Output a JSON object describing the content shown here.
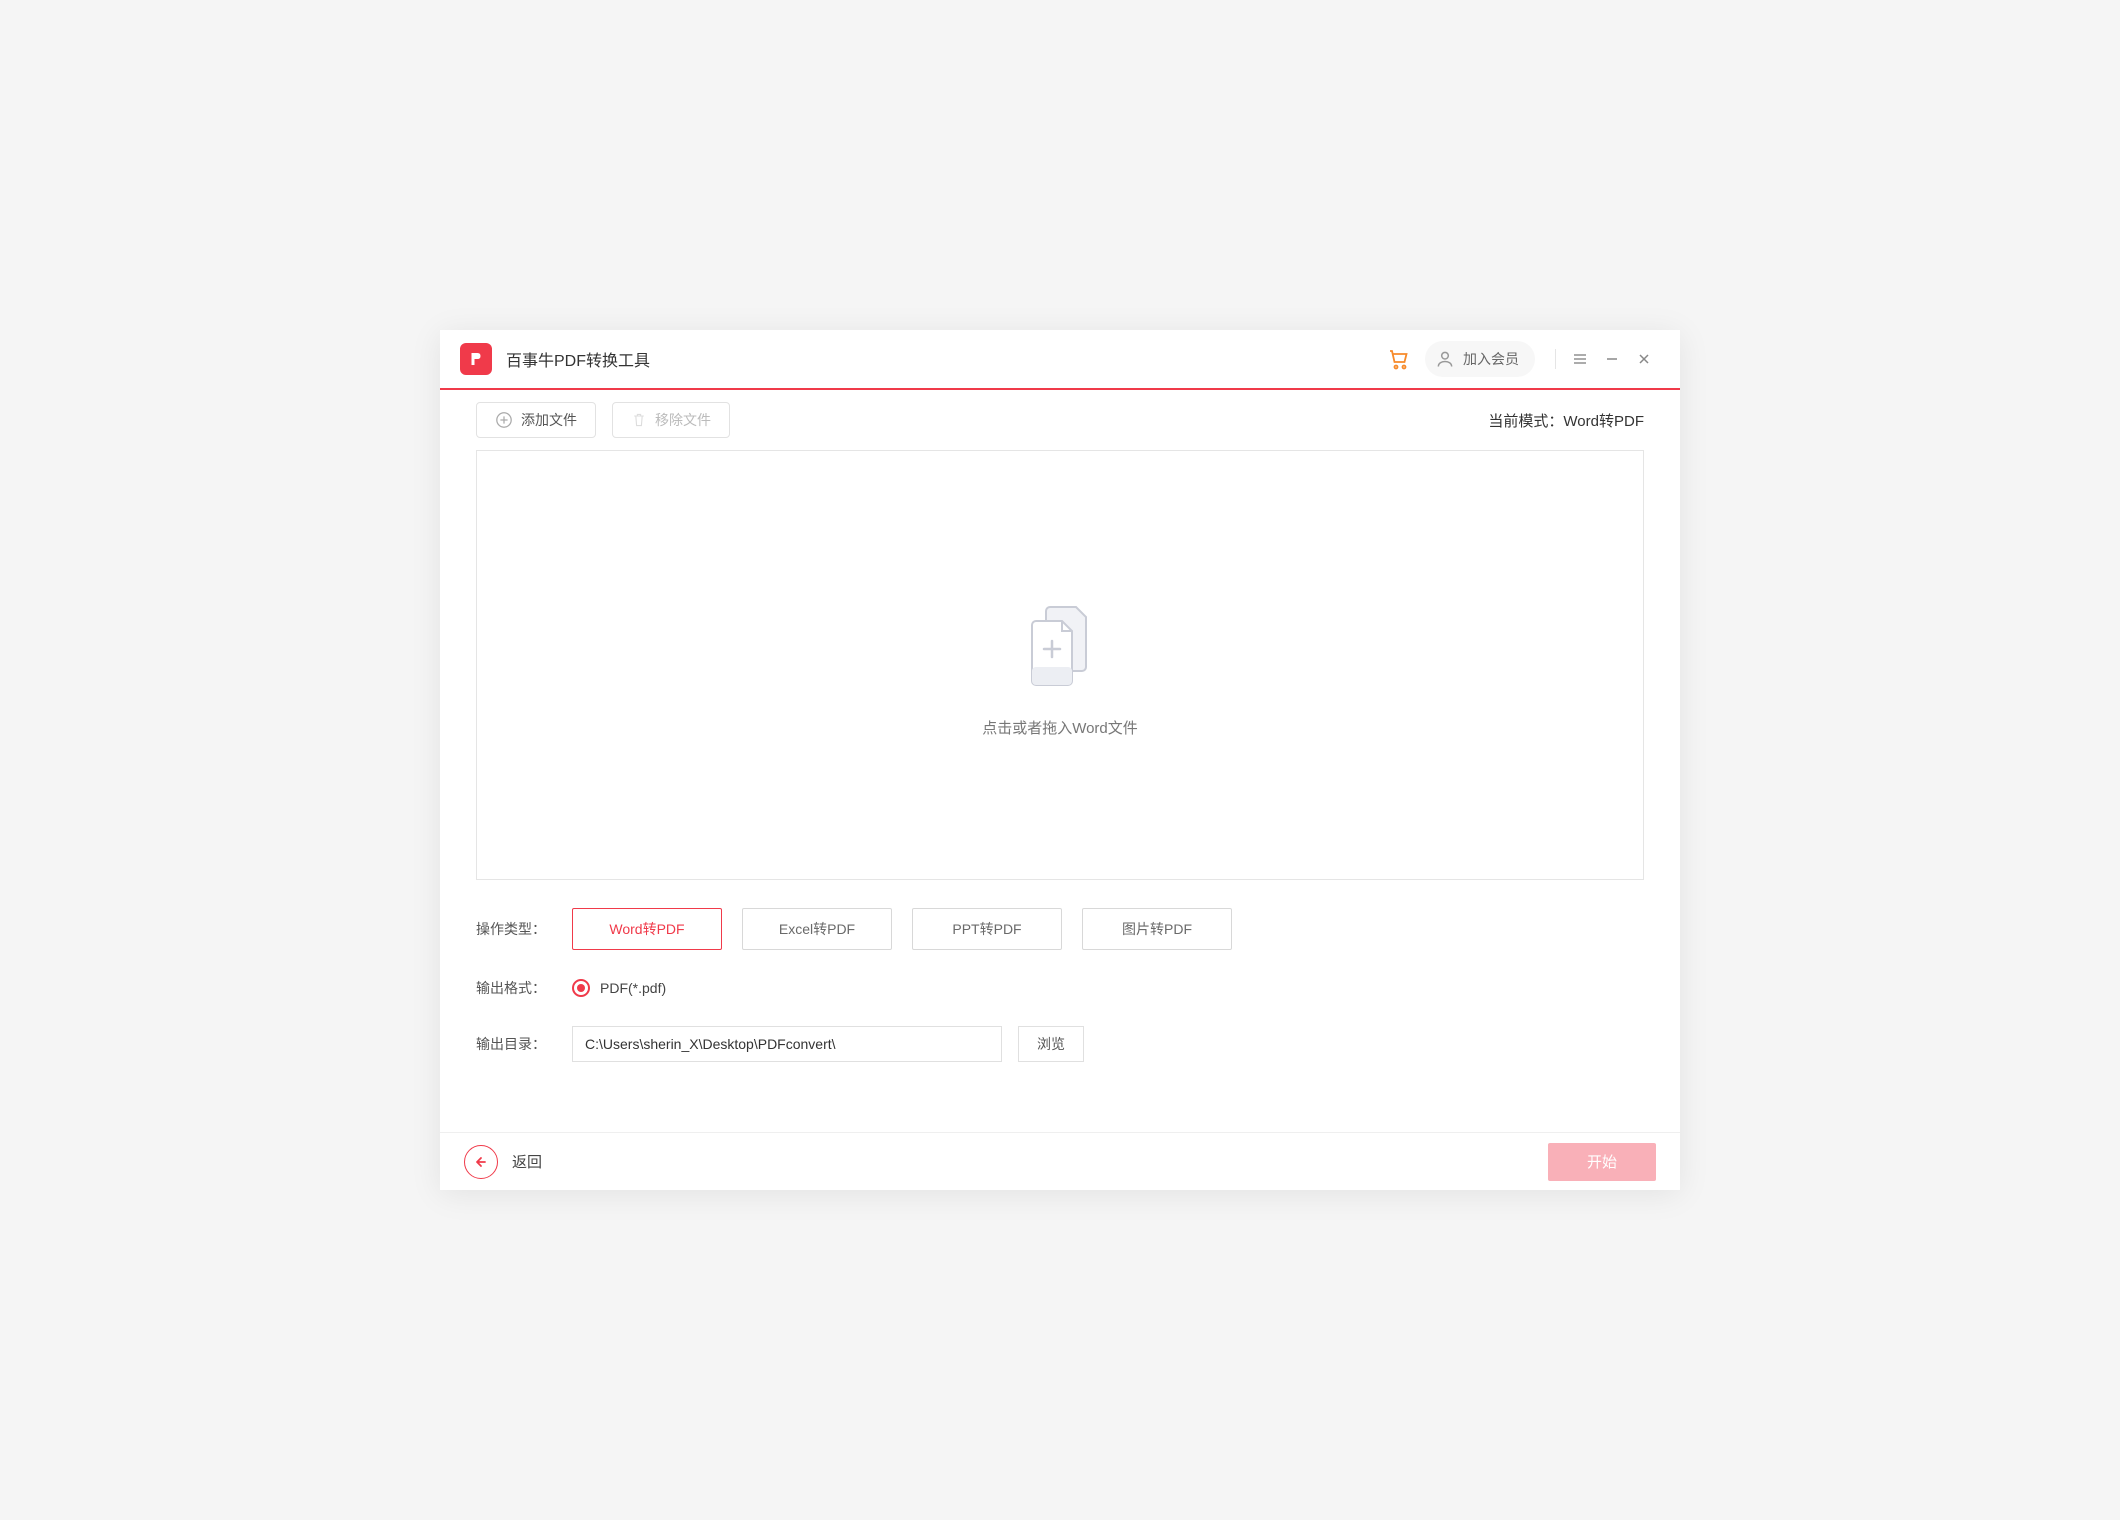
{
  "header": {
    "app_title": "百事牛PDF转换工具",
    "member_label": "加入会员"
  },
  "toolbar": {
    "add_file_label": "添加文件",
    "remove_file_label": "移除文件",
    "mode_prefix": "当前模式：",
    "mode_value": "Word转PDF"
  },
  "dropzone": {
    "hint": "点击或者拖入Word文件"
  },
  "form": {
    "type_label": "操作类型：",
    "types": [
      {
        "label": "Word转PDF",
        "active": true
      },
      {
        "label": "Excel转PDF",
        "active": false
      },
      {
        "label": "PPT转PDF",
        "active": false
      },
      {
        "label": "图片转PDF",
        "active": false
      }
    ],
    "format_label": "输出格式：",
    "format_value": "PDF(*.pdf)",
    "output_dir_label": "输出目录：",
    "output_dir_value": "C:\\Users\\sherin_X\\Desktop\\PDFconvert\\",
    "browse_label": "浏览"
  },
  "footer": {
    "back_label": "返回",
    "start_label": "开始"
  }
}
